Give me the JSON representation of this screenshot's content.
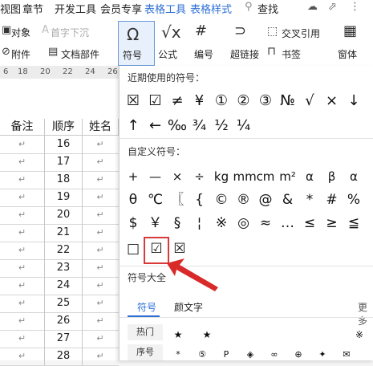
{
  "menubar": {
    "items": [
      "视图",
      "章节",
      "开发工具",
      "会员专享"
    ],
    "accent_items": [
      "表格工具",
      "表格样式"
    ],
    "search_label": "查找",
    "accent_color": "#2d6fd6"
  },
  "ribbon": {
    "object_label": "对象",
    "sink_label": "首字下沉",
    "attachment_label": "附件",
    "doc_parts_label": "文档部件",
    "symbol_label": "符号",
    "formula_label": "公式",
    "numbering_label": "编号",
    "hyperlink_label": "超链接",
    "crossref_label": "交叉引用",
    "bookmark_label": "书签",
    "window_label": "窗体"
  },
  "ruler": {
    "ticks": [
      "6",
      "18",
      "20",
      "22",
      "24",
      "26"
    ]
  },
  "sheet": {
    "headers": [
      "备注",
      "顺序",
      "姓名"
    ],
    "rows": [
      {
        "note": "↵",
        "order": "16",
        "name": "↵"
      },
      {
        "note": "↵",
        "order": "17",
        "name": "↵"
      },
      {
        "note": "↵",
        "order": "18",
        "name": "↵"
      },
      {
        "note": "↵",
        "order": "19",
        "name": "↵"
      },
      {
        "note": "↵",
        "order": "20",
        "name": "↵"
      },
      {
        "note": "↵",
        "order": "21",
        "name": "↵"
      },
      {
        "note": "↵",
        "order": "22",
        "name": "↵"
      },
      {
        "note": "↵",
        "order": "23",
        "name": "↵"
      },
      {
        "note": "↵",
        "order": "24",
        "name": "↵"
      },
      {
        "note": "↵",
        "order": "25",
        "name": "↵"
      },
      {
        "note": "↵",
        "order": "26",
        "name": "↵"
      },
      {
        "note": "↵",
        "order": "27",
        "name": "↵"
      },
      {
        "note": "↵",
        "order": "28",
        "name": "↵"
      }
    ]
  },
  "dropdown": {
    "recent_title": "近期使用的符号：",
    "recent_row1": [
      "☒",
      "☑",
      "≠",
      "¥",
      "①",
      "②",
      "③",
      "№",
      "√",
      "×",
      "↓"
    ],
    "recent_row2": [
      "↑",
      "←",
      "‰",
      "¾",
      "½",
      "¼"
    ],
    "custom_title": "自定义符号：",
    "custom_row1": [
      "+",
      "—",
      "×",
      "÷",
      "kg",
      "mm",
      "cm",
      "m²",
      "α",
      "β",
      "α"
    ],
    "custom_row2": [
      "θ",
      "℃",
      "〖",
      "{",
      "©",
      "®",
      "@",
      "&",
      "*",
      "#",
      "%"
    ],
    "custom_row3": [
      "$",
      "￥",
      "§",
      "¦",
      "※",
      "◎",
      "≈",
      "…",
      "≤",
      "≥",
      "≦"
    ],
    "custom_row4": [
      "□",
      "☑",
      "☒"
    ],
    "all_title": "符号大全",
    "tab_symbol": "符号",
    "tab_emoticon": "颜文字",
    "more_label": "更多",
    "cat_hot": "热门",
    "cat_order": "序号",
    "hot_symbols": [
      "★",
      "★",
      "※"
    ],
    "order_symbols": [
      "*",
      "⑤",
      "P",
      "◈",
      "∞",
      "⊕",
      "✦",
      "✉"
    ]
  }
}
